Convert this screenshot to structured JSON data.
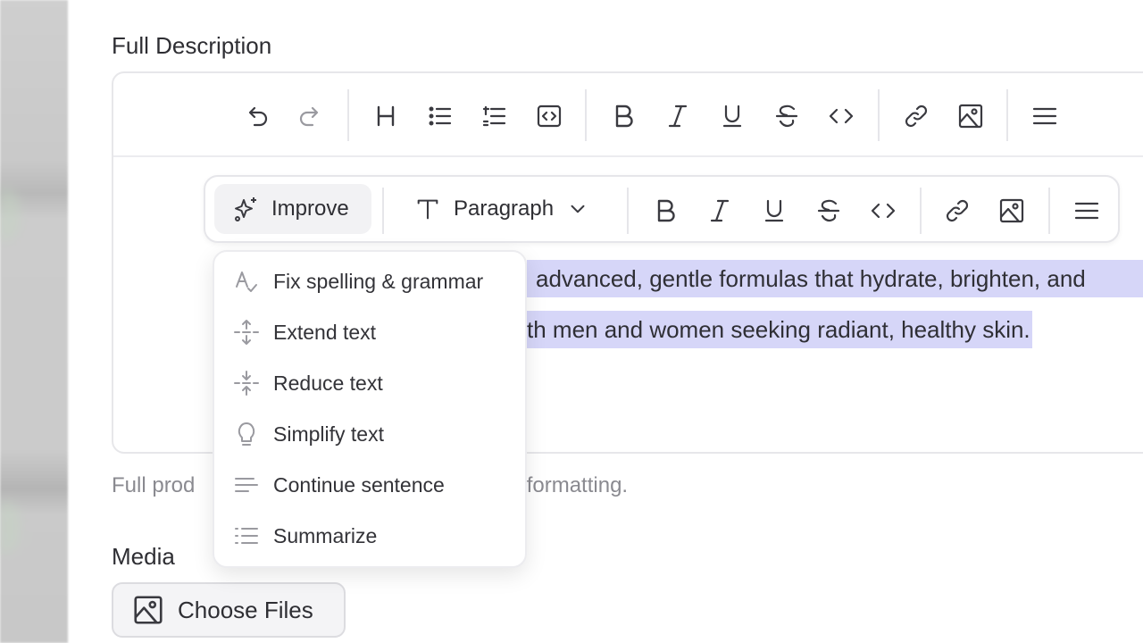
{
  "labels": {
    "full_description": "Full Description",
    "media": "Media"
  },
  "editor": {
    "toolbar": {
      "icons": [
        "undo-icon",
        "redo-icon",
        "heading-icon",
        "bullet-list-icon",
        "ordered-list-icon",
        "code-block-icon",
        "bold-icon",
        "italic-icon",
        "underline-icon",
        "strikethrough-icon",
        "code-icon",
        "link-icon",
        "image-icon",
        "align-icon"
      ]
    },
    "bubble": {
      "improve_label": "Improve",
      "paragraph_label": "Paragraph"
    },
    "content": {
      "line1": "advanced, gentle formulas that hydrate, brighten, and",
      "line2": "th men and women seeking radiant, healthy skin."
    }
  },
  "helper": {
    "left": "Full prod",
    "right": "xt formatting."
  },
  "improve_menu": {
    "items": [
      {
        "label": "Fix spelling & grammar",
        "icon": "spellcheck-icon"
      },
      {
        "label": "Extend text",
        "icon": "extend-icon"
      },
      {
        "label": "Reduce text",
        "icon": "reduce-icon"
      },
      {
        "label": "Simplify text",
        "icon": "lightbulb-icon"
      },
      {
        "label": "Continue sentence",
        "icon": "continue-lines-icon"
      },
      {
        "label": "Summarize",
        "icon": "list-icon"
      }
    ]
  },
  "media": {
    "choose_files_label": "Choose Files"
  },
  "colors": {
    "selection": "#d6d6f8",
    "border": "#e7e7ea",
    "text": "#2b2b2f",
    "muted": "#8a8a90"
  }
}
